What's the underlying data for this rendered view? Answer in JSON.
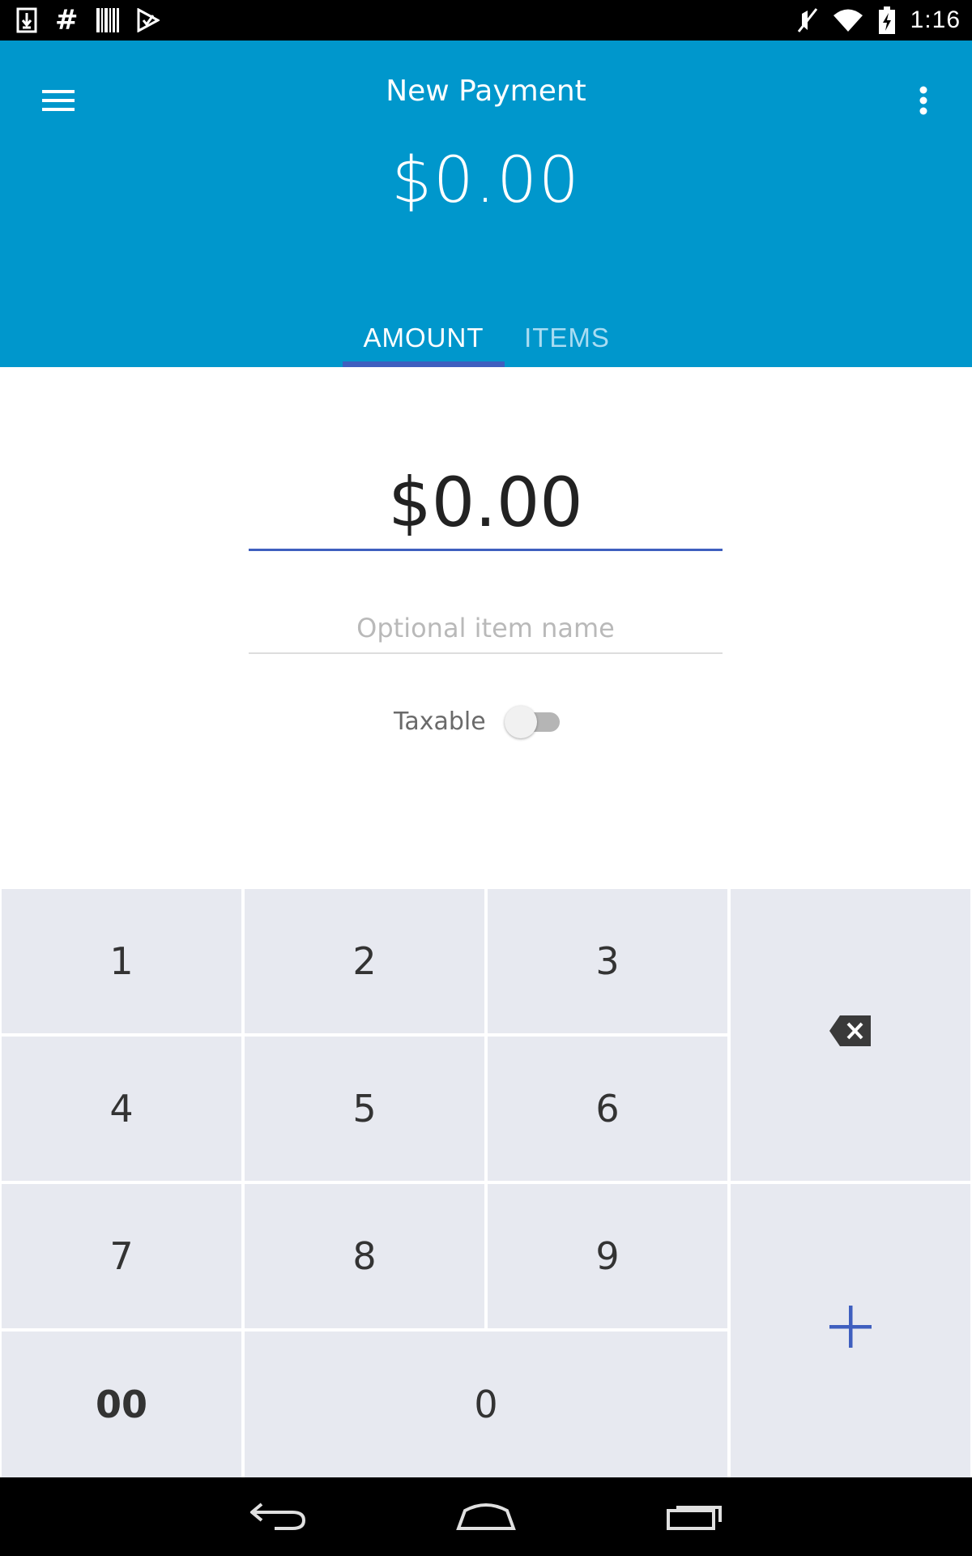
{
  "status_bar": {
    "time": "1:16",
    "left_icons": [
      "download-icon",
      "hash-icon",
      "barcode-icon",
      "play-store-icon"
    ],
    "right_icons": [
      "mute-icon",
      "wifi-icon",
      "battery-icon"
    ]
  },
  "app_bar": {
    "title": "New Payment",
    "total": "$0.00",
    "background_color": "#0097cc",
    "tabs": [
      {
        "label": "AMOUNT",
        "selected": true
      },
      {
        "label": "ITEMS",
        "selected": false
      }
    ]
  },
  "form": {
    "amount_value": "$0.00",
    "item_name_placeholder": "Optional item name",
    "item_name_value": "",
    "taxable_label": "Taxable",
    "taxable_on": false
  },
  "keypad": {
    "keys": [
      "1",
      "2",
      "3",
      "4",
      "5",
      "6",
      "7",
      "8",
      "9",
      "00",
      "0"
    ],
    "backspace_icon": "backspace-icon",
    "add_icon": "plus-icon",
    "accent_color": "#3f5fbf",
    "key_color": "#e7e9f0"
  },
  "nav_bar": {
    "buttons": [
      "back-icon",
      "home-icon",
      "recents-icon"
    ]
  }
}
